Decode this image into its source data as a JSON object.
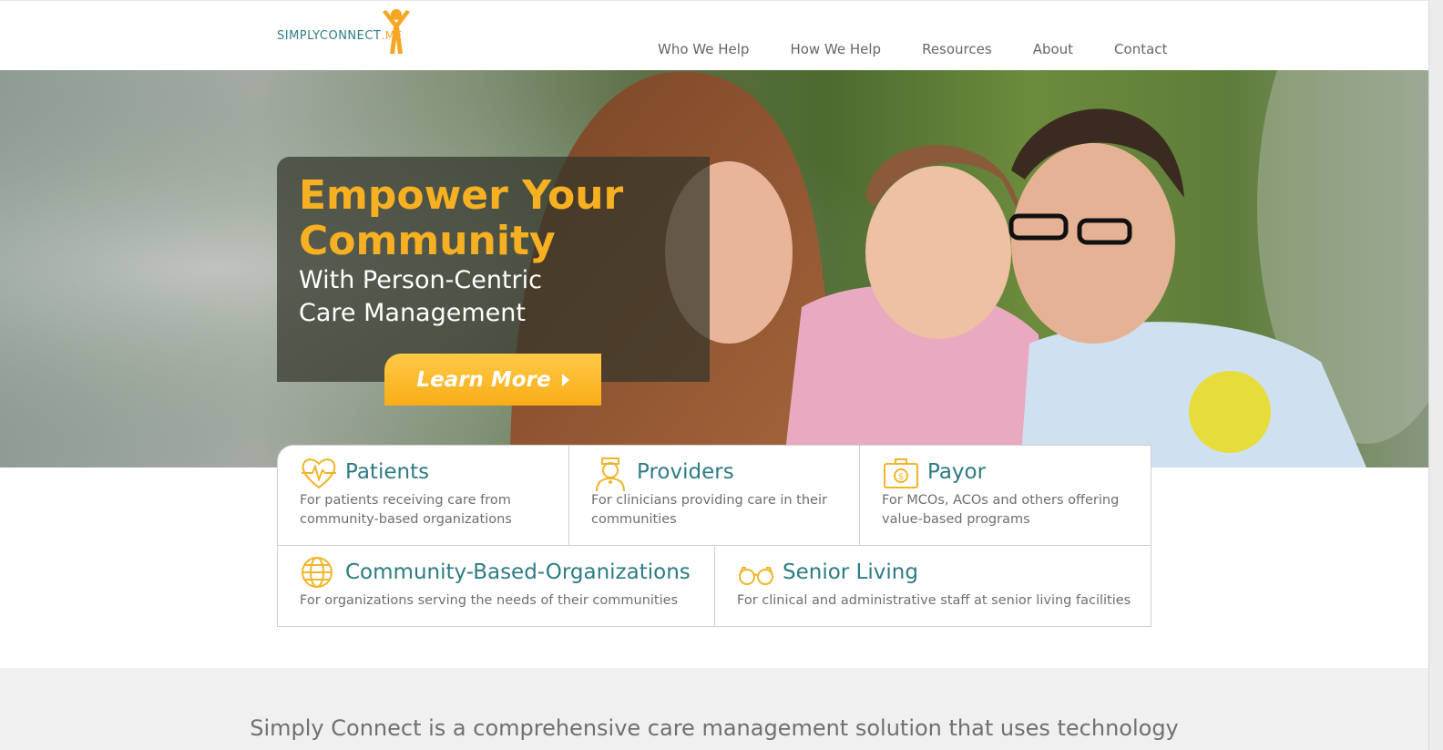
{
  "header": {
    "logo": {
      "text": "SIMPLYCONNECT",
      "suffix": ".ME",
      "icon": "person-arms-up-icon"
    },
    "nav": [
      {
        "label": "Who We Help"
      },
      {
        "label": "How We Help"
      },
      {
        "label": "Resources"
      },
      {
        "label": "About"
      },
      {
        "label": "Contact"
      }
    ]
  },
  "hero": {
    "title": "Empower Your Community",
    "subtitle": "With Person-Centric Care Management",
    "button_label": "Learn More",
    "button_icon": "caret-right-icon"
  },
  "cards": [
    {
      "icon": "heartbeat-icon",
      "title": "Patients",
      "description": "For patients receiving care from community-based organizations"
    },
    {
      "icon": "nurse-icon",
      "title": "Providers",
      "description": "For clinicians providing care in their communities"
    },
    {
      "icon": "money-case-icon",
      "title": "Payor",
      "description": "For MCOs, ACOs and others offering value-based programs"
    },
    {
      "icon": "globe-icon",
      "title": "Community-Based-Organizations",
      "description": "For organizations serving the needs of their communities"
    },
    {
      "icon": "glasses-icon",
      "title": "Senior Living",
      "description": "For clinical and administrative staff at senior living facilities"
    }
  ],
  "intro": {
    "text": "Simply Connect is a comprehensive care management solution that uses technology"
  },
  "colors": {
    "accent": "#f7b021",
    "teal": "#2d7b83",
    "nav_text": "#666666"
  }
}
